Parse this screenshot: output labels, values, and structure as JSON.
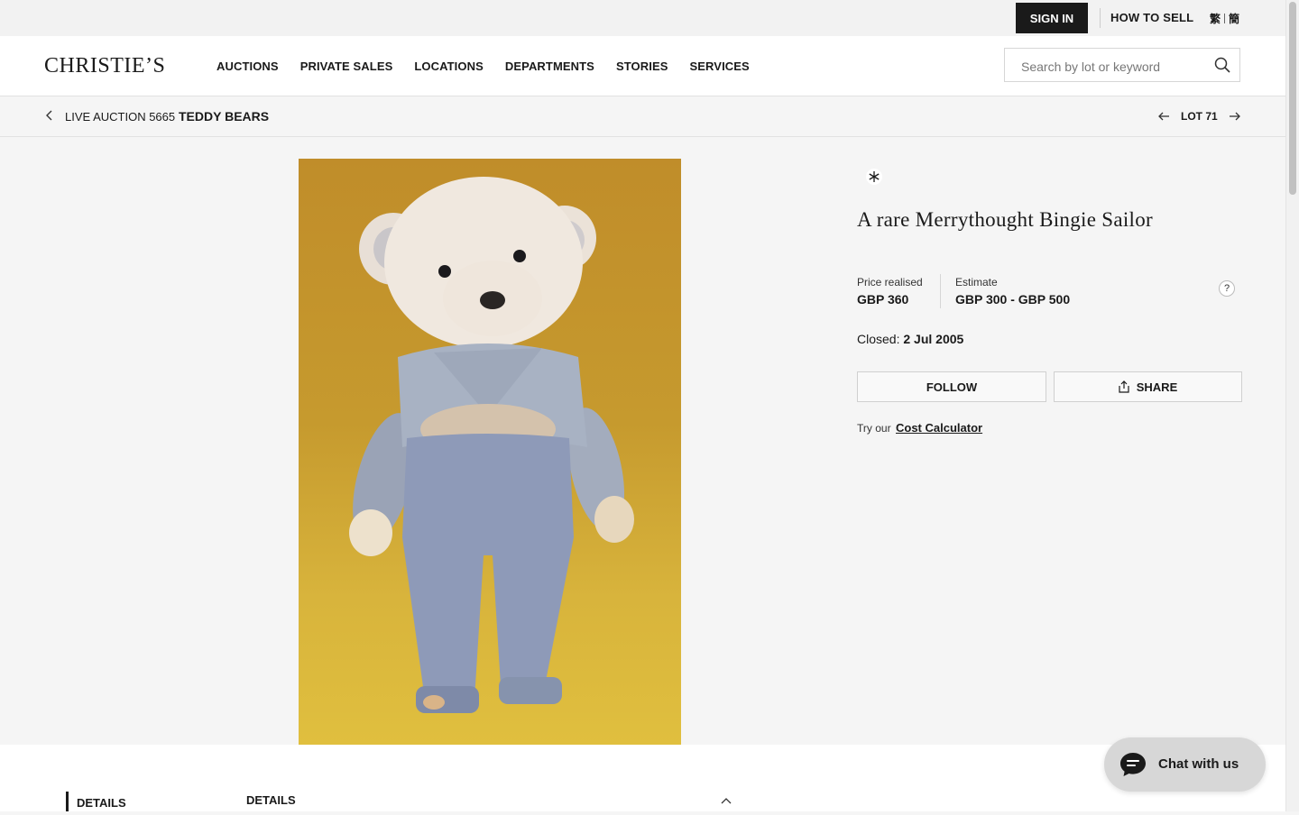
{
  "topbar": {
    "sign_in_label": "SIGN IN",
    "how_to_sell_label": "HOW TO SELL",
    "lang_traditional": "繁",
    "lang_simplified": "簡"
  },
  "header": {
    "logo": "CHRISTIE’S",
    "nav": [
      "AUCTIONS",
      "PRIVATE SALES",
      "LOCATIONS",
      "DEPARTMENTS",
      "STORIES",
      "SERVICES"
    ],
    "search_placeholder": "Search by lot or keyword"
  },
  "breadcrumb": {
    "prefix": "LIVE AUCTION 5665",
    "sale_title": "TEDDY BEARS",
    "lot_label": "LOT 71"
  },
  "lot": {
    "image_alt": "Merrythought Bingie Sailor teddy bear",
    "title": "A rare Merrythought Bingie Sailor",
    "price_realised_label": "Price realised",
    "price_realised_value": "GBP 360",
    "estimate_label": "Estimate",
    "estimate_value": "GBP 300 - GBP 500",
    "help_glyph": "?",
    "closed_label": "Closed:",
    "closed_date": "2 Jul 2005",
    "follow_label": "FOLLOW",
    "share_label": "SHARE",
    "try_label": "Try our",
    "cost_calc_label": "Cost Calculator"
  },
  "details": {
    "side_label": "DETAILS",
    "heading": "DETAILS"
  },
  "chat": {
    "label": "Chat with us"
  },
  "colors": {
    "accent_dark": "#1a1a1a",
    "page_bg": "#f5f5f5",
    "image_bg": "#c69a2e"
  }
}
